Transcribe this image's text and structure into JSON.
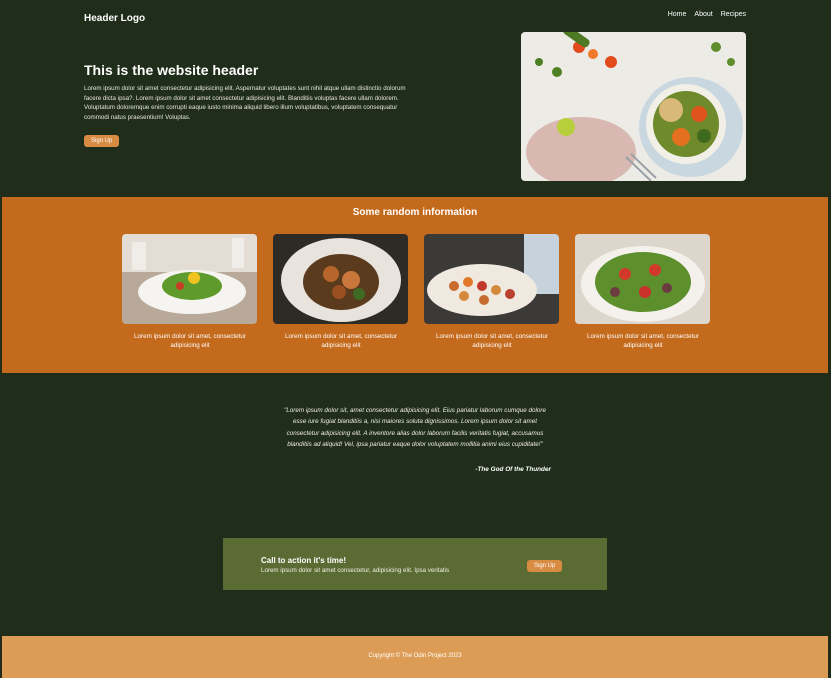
{
  "header": {
    "logo": "Header Logo",
    "nav": [
      "Home",
      "About",
      "Recipes"
    ]
  },
  "hero": {
    "title": "This is the website header",
    "body": "Lorem ipsum dolor sit amet consectetur adipisicing elit. Aspernatur voluptates sunt nihil atque ullam distinctio dolorum facere dicta ipsa?. Lorem ipsum dolor sit amet consectetur adipisicing elit. Blanditiis voluptas facere ullam dolorem. Voluptatum doloremque enim corrupti eaque iusto minima aliquid libero illum voluptatibus, voluptatem consequatur commodi natus praesentium! Voluptas.",
    "button": "Sign Up"
  },
  "info": {
    "title": "Some random information",
    "cards": [
      {
        "caption": "Lorem ipsum dolor sit amet, consectetur adipisicing elit"
      },
      {
        "caption": "Lorem ipsum dolor sit amet, consectetur adipisicing elit"
      },
      {
        "caption": "Lorem ipsum dolor sit amet, consectetur adipisicing elit"
      },
      {
        "caption": "Lorem ipsum dolor sit amet, consectetur adipisicing elit"
      }
    ]
  },
  "quote": {
    "text": "\"Lorem ipsum dolor sit, amet consectetur adipisicing elit. Eius pariatur laborum cumque dolore esse iure fugiat blanditiis a, nisi maiores soluta dignissimos. Lorem ipsum dolor sit amet consectetur adipisicing elit. A inventore alias dolor laborum facilis veritatis fugiat, accusamus blanditiis ad aliquid! Vel, ipsa pariatur eaque dolor voluptatem mollitia animi eius cupiditate!\"",
    "author": "-The God Of the Thunder"
  },
  "cta": {
    "title": "Call to action it's time!",
    "body": "Lorem ipsum dolor sit amet consectetur, adipisicing elit. Ipsa veritatis",
    "button": "Sign Up"
  },
  "footer": {
    "text": "Copyright © The Odin Project 2023"
  },
  "colors": {
    "background": "#1f2d1a",
    "band": "#c46a1c",
    "button": "#d88b42",
    "cta": "#5b6b34",
    "footer": "#dc9c55"
  }
}
